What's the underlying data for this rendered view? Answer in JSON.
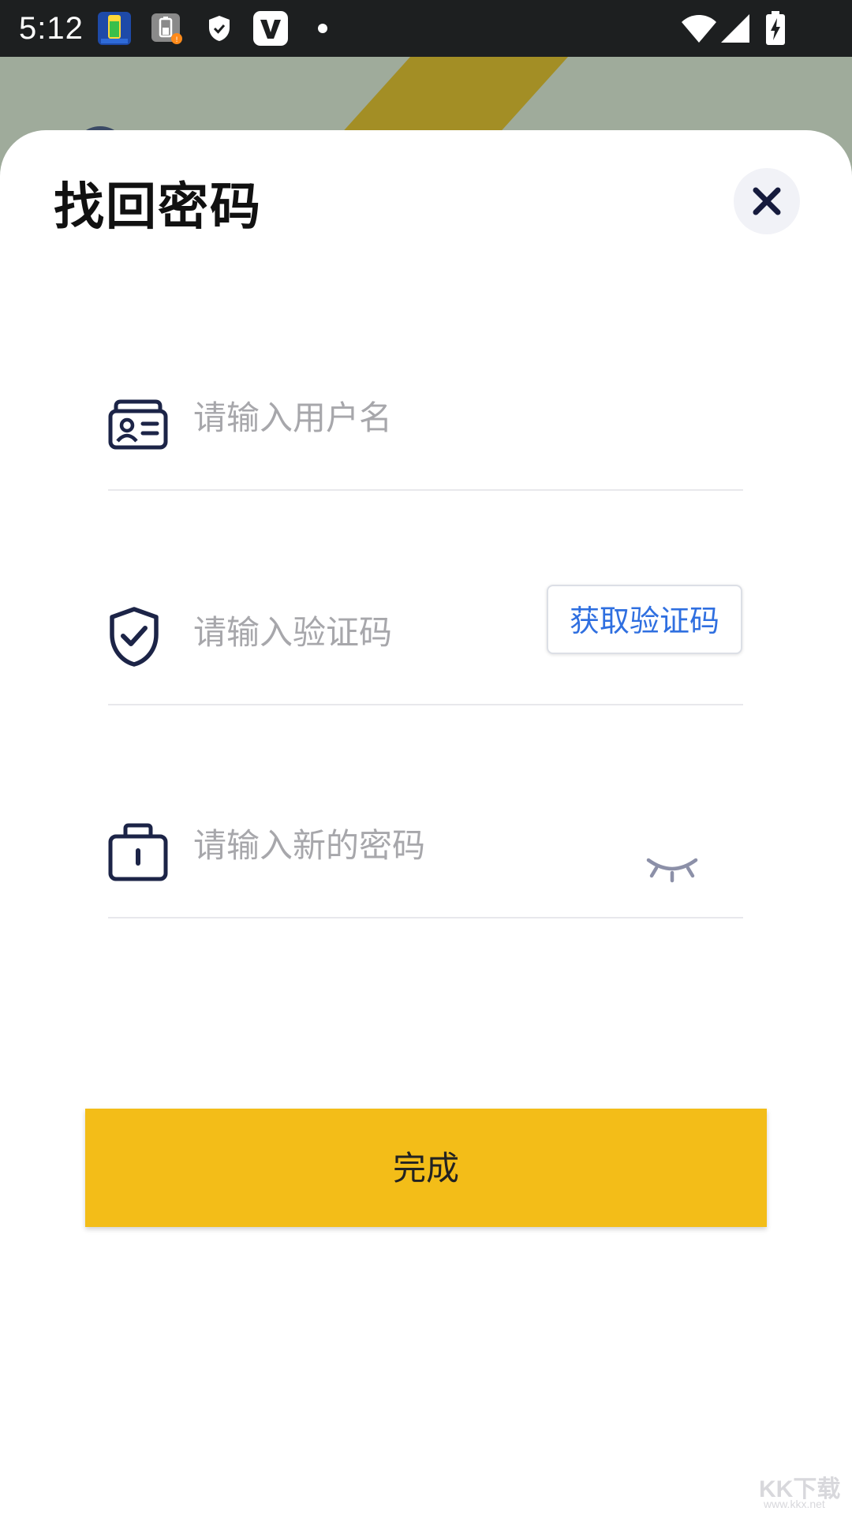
{
  "status_bar": {
    "time": "5:12",
    "icons": [
      "app-notification-icon",
      "battery-alert-icon",
      "shield-icon",
      "v-app-icon",
      "dot-icon",
      "wifi-icon",
      "cell-signal-icon",
      "battery-charging-icon"
    ]
  },
  "sheet": {
    "title": "找回密码",
    "close_icon": "close-icon"
  },
  "form": {
    "username": {
      "placeholder": "请输入用户名",
      "value": "",
      "icon": "id-card-icon"
    },
    "code": {
      "placeholder": "请输入验证码",
      "value": "",
      "icon": "shield-check-icon",
      "button_label": "获取验证码"
    },
    "password": {
      "placeholder": "请输入新的密码",
      "value": "",
      "icon": "lock-icon",
      "toggle_icon": "eye-closed-icon"
    }
  },
  "submit": {
    "label": "完成"
  },
  "watermark": {
    "text": "KK下载",
    "sub": "www.kkx.net"
  },
  "colors": {
    "accent": "#f3bd18",
    "link": "#2f6fe0",
    "icon": "#1c2447",
    "placeholder": "#a7a7ab"
  }
}
